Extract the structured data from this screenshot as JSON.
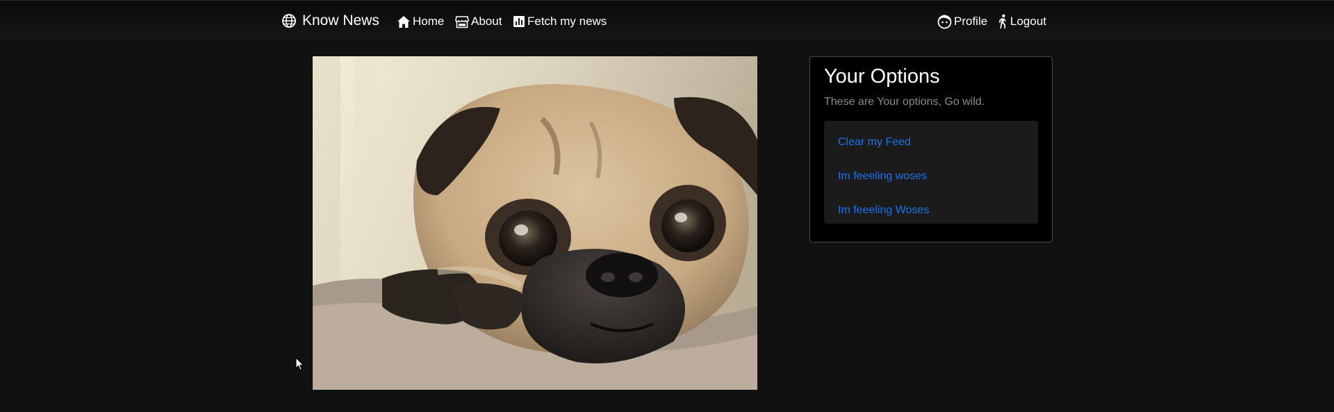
{
  "navbar": {
    "brand": {
      "label": "Know News",
      "icon": "globe-icon"
    },
    "left_links": [
      {
        "label": "Home",
        "icon": "home-icon"
      },
      {
        "label": "About",
        "icon": "store-icon"
      },
      {
        "label": "Fetch my news",
        "icon": "bar-chart-icon"
      }
    ],
    "right_links": [
      {
        "label": "Profile",
        "icon": "face-icon"
      },
      {
        "label": "Logout",
        "icon": "running-person-icon"
      }
    ]
  },
  "main": {
    "image": {
      "subject": "pug-photo"
    }
  },
  "options_card": {
    "title": "Your Options",
    "subtitle": "These are Your options, Go wild.",
    "items": [
      {
        "label": "Clear my Feed"
      },
      {
        "label": "Im feeeling woses"
      },
      {
        "label": "Im feeeling Woses"
      }
    ]
  },
  "colors": {
    "background": "#111111",
    "card_background": "#000000",
    "list_background": "#1b1b1c",
    "link": "#1a73e8",
    "muted_text": "#8a8a8a"
  }
}
